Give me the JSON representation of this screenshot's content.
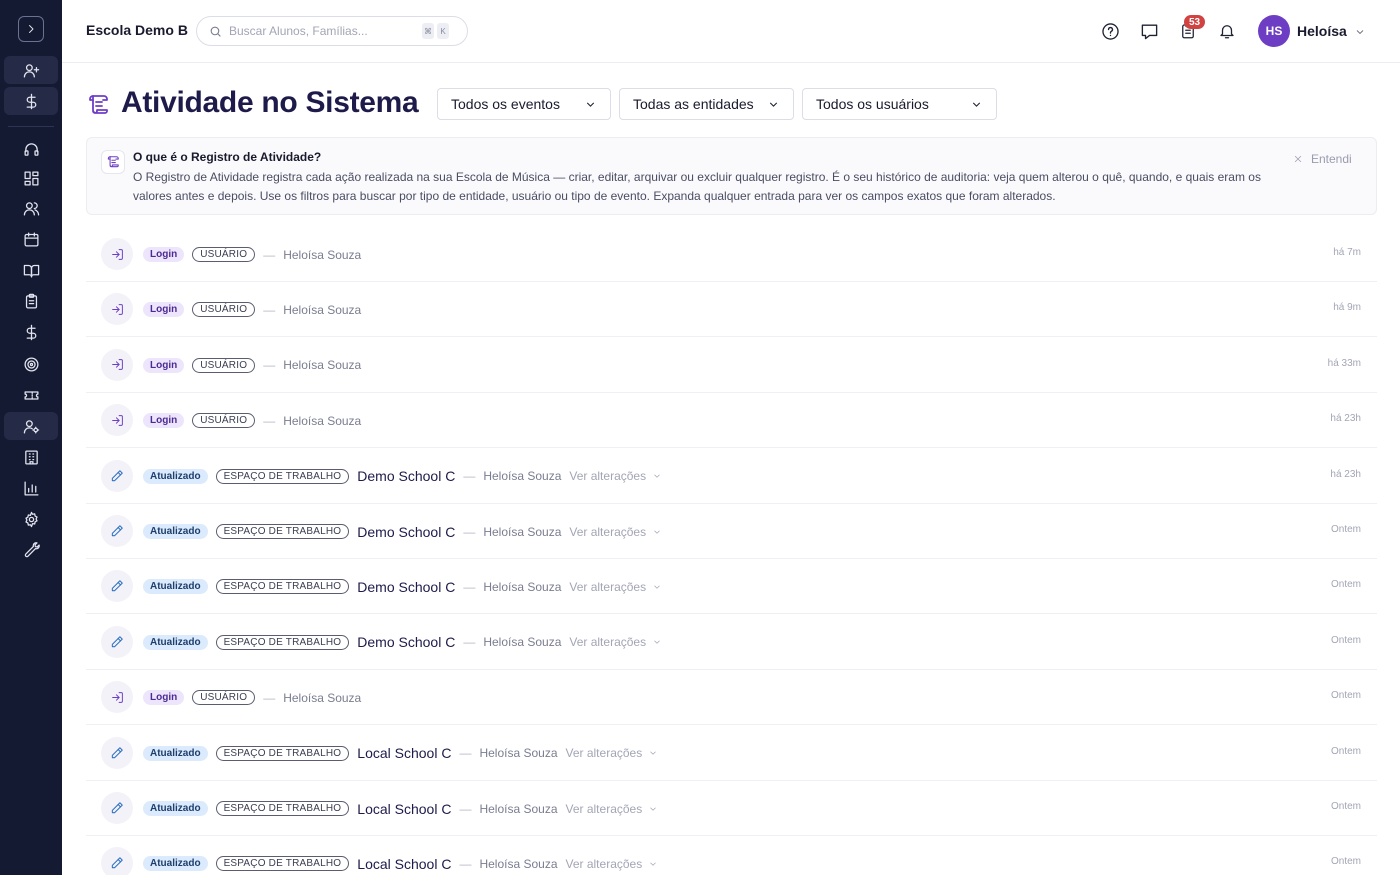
{
  "header": {
    "school_name": "Escola Demo B",
    "search_placeholder": "Buscar Alunos, Famílias...",
    "shortcut_keys": [
      "⌘",
      "K"
    ],
    "notification_count": "53",
    "user": {
      "initials": "HS",
      "name": "Heloísa"
    }
  },
  "sidebar": {
    "items": [
      {
        "icon": "user-plus-icon",
        "active": true
      },
      {
        "icon": "dollar-icon",
        "active": true
      },
      {
        "icon": "headset-icon",
        "active": false
      },
      {
        "icon": "grid-icon",
        "active": false
      },
      {
        "icon": "users-icon",
        "active": false
      },
      {
        "icon": "calendar-icon",
        "active": false
      },
      {
        "icon": "book-open-icon",
        "active": false
      },
      {
        "icon": "clipboard-icon",
        "active": false
      },
      {
        "icon": "dollar-icon",
        "active": false
      },
      {
        "icon": "target-icon",
        "active": false
      },
      {
        "icon": "ticket-icon",
        "active": false
      },
      {
        "icon": "user-cog-icon",
        "active": true
      },
      {
        "icon": "building-icon",
        "active": false
      },
      {
        "icon": "bar-chart-icon",
        "active": false
      },
      {
        "icon": "gear-icon",
        "active": false
      },
      {
        "icon": "wrench-icon",
        "active": false
      }
    ]
  },
  "page": {
    "title": "Atividade no Sistema",
    "filters": {
      "events": "Todos os eventos",
      "entities": "Todas as entidades",
      "users": "Todos os usuários"
    }
  },
  "info": {
    "title": "O que é o Registro de Atividade?",
    "body": "O Registro de Atividade registra cada ação realizada na sua Escola de Música — criar, editar, arquivar ou excluir qualquer registro. É o seu histórico de auditoria: veja quem alterou o quê, quando, e quais eram os valores antes e depois. Use os filtros para buscar por tipo de entidade, usuário ou tipo de evento. Expanda qualquer entrada para ver os campos exatos que foram alterados.",
    "dismiss_label": "Entendi"
  },
  "activity": [
    {
      "type": "login",
      "event": "Login",
      "entity": "USUÁRIO",
      "name": "",
      "actor": "Heloísa Souza",
      "changes": "",
      "time": "há 7m"
    },
    {
      "type": "login",
      "event": "Login",
      "entity": "USUÁRIO",
      "name": "",
      "actor": "Heloísa Souza",
      "changes": "",
      "time": "há 9m"
    },
    {
      "type": "login",
      "event": "Login",
      "entity": "USUÁRIO",
      "name": "",
      "actor": "Heloísa Souza",
      "changes": "",
      "time": "há 33m"
    },
    {
      "type": "login",
      "event": "Login",
      "entity": "USUÁRIO",
      "name": "",
      "actor": "Heloísa Souza",
      "changes": "",
      "time": "há 23h"
    },
    {
      "type": "update",
      "event": "Atualizado",
      "entity": "ESPAÇO DE TRABALHO",
      "name": "Demo School C",
      "actor": "Heloísa Souza",
      "changes": "Ver alterações",
      "time": "há 23h"
    },
    {
      "type": "update",
      "event": "Atualizado",
      "entity": "ESPAÇO DE TRABALHO",
      "name": "Demo School C",
      "actor": "Heloísa Souza",
      "changes": "Ver alterações",
      "time": "Ontem"
    },
    {
      "type": "update",
      "event": "Atualizado",
      "entity": "ESPAÇO DE TRABALHO",
      "name": "Demo School C",
      "actor": "Heloísa Souza",
      "changes": "Ver alterações",
      "time": "Ontem"
    },
    {
      "type": "update",
      "event": "Atualizado",
      "entity": "ESPAÇO DE TRABALHO",
      "name": "Demo School C",
      "actor": "Heloísa Souza",
      "changes": "Ver alterações",
      "time": "Ontem"
    },
    {
      "type": "login",
      "event": "Login",
      "entity": "USUÁRIO",
      "name": "",
      "actor": "Heloísa Souza",
      "changes": "",
      "time": "Ontem"
    },
    {
      "type": "update",
      "event": "Atualizado",
      "entity": "ESPAÇO DE TRABALHO",
      "name": "Local School C",
      "actor": "Heloísa Souza",
      "changes": "Ver alterações",
      "time": "Ontem"
    },
    {
      "type": "update",
      "event": "Atualizado",
      "entity": "ESPAÇO DE TRABALHO",
      "name": "Local School C",
      "actor": "Heloísa Souza",
      "changes": "Ver alterações",
      "time": "Ontem"
    },
    {
      "type": "update",
      "event": "Atualizado",
      "entity": "ESPAÇO DE TRABALHO",
      "name": "Local School C",
      "actor": "Heloísa Souza",
      "changes": "Ver alterações",
      "time": "Ontem"
    }
  ]
}
